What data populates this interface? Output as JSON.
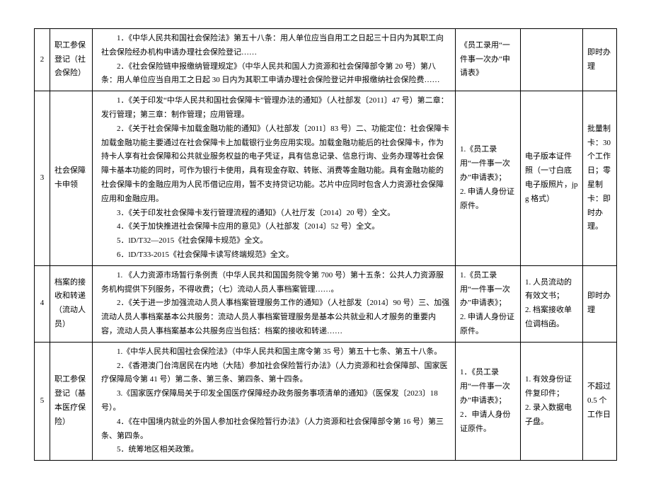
{
  "rows": [
    {
      "idx": "2",
      "name": "职工参保登记（社会保险）",
      "basis": [
        "1．《中华人民共和国社会保险法》第五十八条：用人单位应当自用工之日起三十日内为其职工向社会保险经办机构申请办理社会保险登记……",
        "2．《社会保险链申报缴纳管理规定》（中华人民共和国人力资源和社会保障部令第 20 号）第八条：用人单位应当自用工之日起 30 日内为其职工申请办理社会保险登记并申报缴纳社会保险费……"
      ],
      "materials": [
        "《员工录用“一件事一次办”申请表》"
      ],
      "extras": [],
      "time": "即时办理"
    },
    {
      "idx": "3",
      "name": "社会保障卡申领",
      "basis": [
        "1．《关于印发“中华人民共和国社会保障卡”管理办法的通知》（人社部发〔2011〕47 号）第二章：发行管理；第三章：制作管理；应用管理。",
        "2．《关于社会保障卡加载金融功能的通知》（人社部发〔2011〕83 号）二、功能定位：社会保障卡加载金融功能主要通过在社会保障卡上加载银行业务应用实现。加载金融功能后的社会保障卡，作为持卡人享有社会保障和公共就业服务权益的电子凭证，具有信息记录、信息行询、业务办理等社会保障卡基本功能的同时，可作为银行卡使用，具有现金存取、转账、消费等金融功能。具有金融功能的社会保障卡的金融应用为人民币借记应用，暂不支持贷记功能。芯片中应同时包含人力资源社会保障应用和金融应用。",
        "3．《关于印发社会保障卡发行管理流程的通知》（人社厅发〔2014〕20 号）全文。",
        "4．《关于加快推进社会保障卡应用的意见》（人社部发〔2014〕52 号）全文。",
        "5．lD/T32—2015《社会保障卡规范》全文。",
        "6．lD/T33-2015《社会保障卡读写终端规范》全文。"
      ],
      "materials": [
        "1.《员工录用“一件事一次办”申请表》；",
        "2. 申请人身份证原件。"
      ],
      "extras": [
        "电子版本证件照（一寸白底电子版照片，jpg 格式）"
      ],
      "time": "批量制卡：30个工作日；零星制卡：即时办理。"
    },
    {
      "idx": "4",
      "name": "档案的接收和转递（流动人员）",
      "basis": [
        "1. 《人力资源市场暂行条例责（中华人民共和国国务院令第 700 号）第十五条：公共人力资源服务机构提供下列服务，不得收费；（七）流动人员人事档案管理……。",
        "2．《关于进一步加强流动人员人事档案管理服务工作的通知》（人社部发〔2014〕90 号）三、加强流动人员人事档案基本公共服务：流动人员人事档案管理服务是基本公共就业和人才服务的重要内容，流动人员人事档案基本公共服务应当包括：档案的接收和转递……"
      ],
      "materials": [
        "1.《员工录用“一件事一次办”申请表》；",
        "2. 申请人身份证原件。"
      ],
      "extras": [
        "1. 人员流动的有效文书；",
        "2. 档案接收单位调档函。"
      ],
      "time": "即时办理"
    },
    {
      "idx": "5",
      "name": "职工参保登记（基本医疗保险）",
      "basis": [
        "1.《中华人民共和国社会保险法》（中华人民共和国主席令第 35 号）第五十七条、第五十八条。",
        "2．《香港澳门台湾居民在内地（大陆）参加社会保险暂行办法》（人力资源和社会保障部、国家医疗保障局令第 41 号）第二条、第三条、第四条、第十四条。",
        "3.《国家医疗保障局关于印发全国医疗保障经办政务服务事项清单的通知》（医保发〔2023〕18 号）。",
        "4．《在中国境内就业的外国人参加社会保险暂行办法》（人力资源和社会保障部令第 16 号）第三条、第四条。",
        "5．统筹地区相关政策。"
      ],
      "materials": [
        "1．《员工录用“一件事一次办”申请表》；",
        "2．申请人身份证原件。"
      ],
      "extras": [
        "1. 有效身份证件复印件；",
        "2. 录入数据电子盘。"
      ],
      "time": "不超过 0.5 个工作日"
    }
  ]
}
